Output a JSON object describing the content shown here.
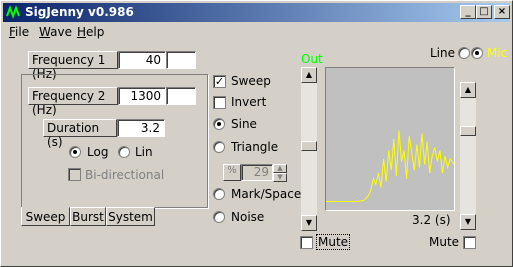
{
  "window": {
    "title": "SigJenny v0.986",
    "buttons": {
      "minimize": "_",
      "maximize": "□",
      "close": "×"
    }
  },
  "menu": [
    {
      "label": "File",
      "u": "F",
      "rest": "ile"
    },
    {
      "label": "Wave",
      "u": "W",
      "rest": "ave"
    },
    {
      "label": "Help",
      "u": "H",
      "rest": "elp"
    }
  ],
  "freq1": {
    "label": "Frequency 1 (Hz)",
    "value": "40"
  },
  "freq2": {
    "label": "Frequency 2 (Hz)",
    "value": "1300"
  },
  "duration": {
    "label": "Duration (s)",
    "value": "3.2"
  },
  "scale": {
    "log_label": "Log",
    "lin_label": "Lin",
    "selected": "log"
  },
  "bidirectional": {
    "label": "Bi-directional",
    "checked": false,
    "disabled": true
  },
  "tabs": [
    "Sweep",
    "Burst",
    "System"
  ],
  "active_tab": "Sweep",
  "options": {
    "sweep": {
      "label": "Sweep",
      "checked": true
    },
    "invert": {
      "label": "Invert",
      "checked": false
    }
  },
  "waveforms": [
    {
      "label": "Sine",
      "selected": true
    },
    {
      "label": "Triangle",
      "selected": false
    },
    {
      "label": "Mark/Space",
      "selected": false
    },
    {
      "label": "Noise",
      "selected": false
    }
  ],
  "mark_space_percent": {
    "label": "%",
    "value": "29"
  },
  "display": {
    "out_label": "Out",
    "out_color": "#00ff00",
    "line_label": "Line",
    "mic_label": "Mic",
    "mic_color": "#ffff00",
    "source_selected": "mic",
    "time_readout": "3.2 (s)",
    "plot_bg": "#c0c0c0",
    "trace_color": "#ffff00"
  },
  "mute_left": {
    "label": "Mute",
    "checked": false
  },
  "mute_right": {
    "label": "Mute",
    "checked": false
  },
  "trace": [
    [
      0,
      0.94
    ],
    [
      0.05,
      0.94
    ],
    [
      0.1,
      0.94
    ],
    [
      0.15,
      0.94
    ],
    [
      0.2,
      0.94
    ],
    [
      0.25,
      0.94
    ],
    [
      0.3,
      0.93
    ],
    [
      0.33,
      0.9
    ],
    [
      0.35,
      0.86
    ],
    [
      0.37,
      0.78
    ],
    [
      0.39,
      0.82
    ],
    [
      0.41,
      0.74
    ],
    [
      0.43,
      0.84
    ],
    [
      0.45,
      0.64
    ],
    [
      0.47,
      0.8
    ],
    [
      0.49,
      0.58
    ],
    [
      0.51,
      0.72
    ],
    [
      0.53,
      0.5
    ],
    [
      0.55,
      0.76
    ],
    [
      0.57,
      0.44
    ],
    [
      0.59,
      0.66
    ],
    [
      0.61,
      0.58
    ],
    [
      0.63,
      0.78
    ],
    [
      0.65,
      0.48
    ],
    [
      0.67,
      0.6
    ],
    [
      0.69,
      0.72
    ],
    [
      0.71,
      0.54
    ],
    [
      0.73,
      0.7
    ],
    [
      0.75,
      0.46
    ],
    [
      0.77,
      0.68
    ],
    [
      0.79,
      0.52
    ],
    [
      0.81,
      0.74
    ],
    [
      0.83,
      0.62
    ],
    [
      0.85,
      0.56
    ],
    [
      0.87,
      0.66
    ],
    [
      0.89,
      0.58
    ],
    [
      0.91,
      0.74
    ],
    [
      0.93,
      0.62
    ],
    [
      0.95,
      0.7
    ],
    [
      0.97,
      0.64
    ],
    [
      1,
      0.68
    ]
  ]
}
